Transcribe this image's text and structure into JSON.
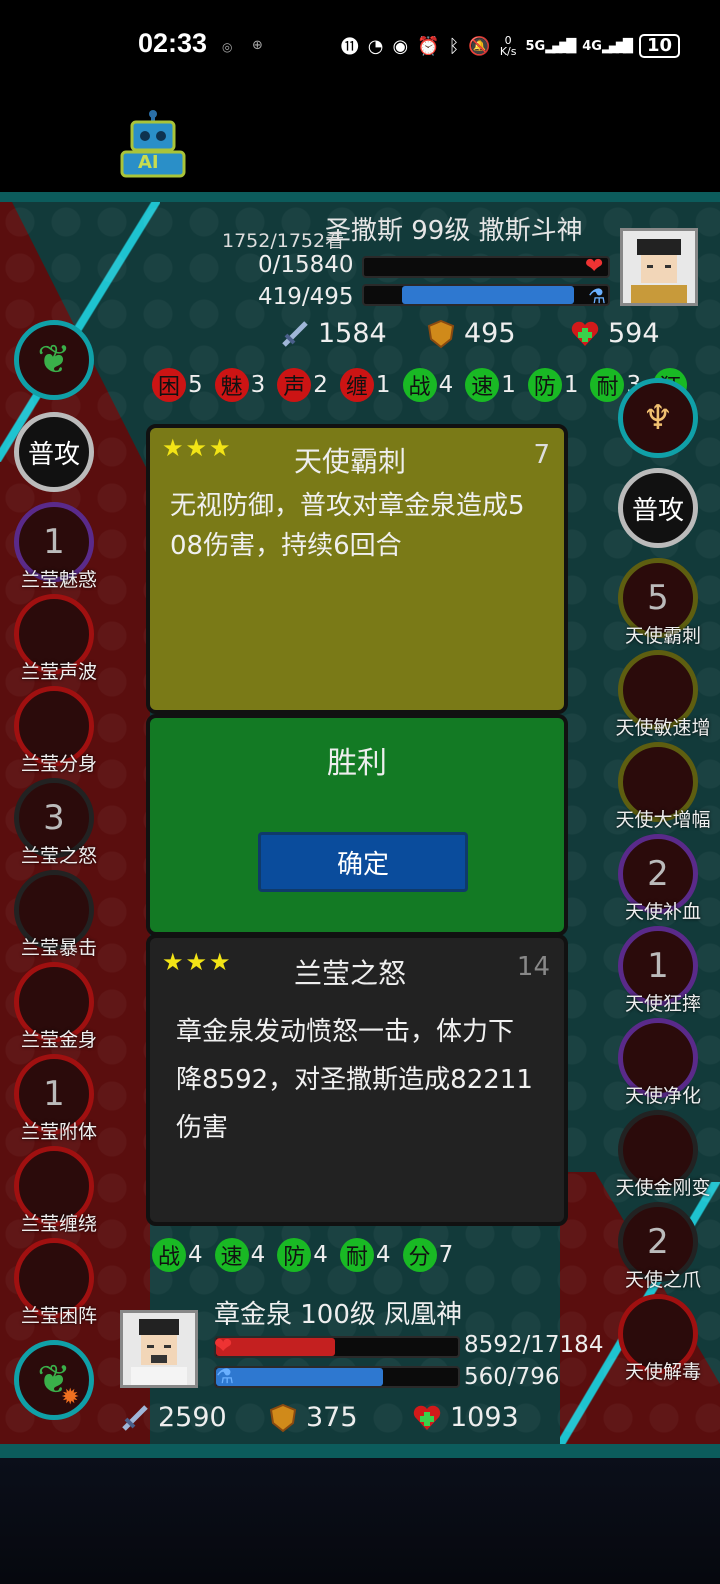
{
  "status_bar": {
    "time": "02:33",
    "net_speed": "0\nK/s",
    "net_5g": "5G",
    "net_4g": "4G",
    "battery": "10"
  },
  "ai_badge": "AI",
  "enemy": {
    "title": "圣撒斯 99级 撒斯斗神",
    "stamina": "1752/1752",
    "stamina_suffix": "看",
    "hp": "0/15840",
    "mp": "419/495",
    "hp_fraction": 0,
    "mp_fraction": 0.85,
    "attack": "1584",
    "defense": "495",
    "heal": "594"
  },
  "enemy_buffs": [
    {
      "label": "困",
      "count": "5",
      "color": "red"
    },
    {
      "label": "魅",
      "count": "3",
      "color": "red"
    },
    {
      "label": "声",
      "count": "2",
      "color": "red"
    },
    {
      "label": "缠",
      "count": "1",
      "color": "red"
    },
    {
      "label": "战",
      "count": "4",
      "color": "green"
    },
    {
      "label": "速",
      "count": "1",
      "color": "green"
    },
    {
      "label": "防",
      "count": "1",
      "color": "green"
    },
    {
      "label": "耐",
      "count": "3",
      "color": "green"
    },
    {
      "label": "狂",
      "count": "",
      "color": "green"
    }
  ],
  "left_skills": {
    "normal_attack": "普攻",
    "items": [
      {
        "label": "兰莹魅惑",
        "value": "1"
      },
      {
        "label": "兰莹声波",
        "value": ""
      },
      {
        "label": "兰莹分身",
        "value": ""
      },
      {
        "label": "兰莹之怒",
        "value": "3"
      },
      {
        "label": "兰莹暴击",
        "value": ""
      },
      {
        "label": "兰莹金身",
        "value": ""
      },
      {
        "label": "兰莹附体",
        "value": "1"
      },
      {
        "label": "兰莹缠绕",
        "value": ""
      },
      {
        "label": "兰莹困阵",
        "value": ""
      }
    ]
  },
  "right_skills": {
    "normal_attack": "普攻",
    "items": [
      {
        "label": "天使霸刺",
        "value": "5"
      },
      {
        "label": "天使敏速增",
        "value": ""
      },
      {
        "label": "天使大增幅",
        "value": ""
      },
      {
        "label": "天使补血",
        "value": "2"
      },
      {
        "label": "天使狂摔",
        "value": "1"
      },
      {
        "label": "天使净化",
        "value": ""
      },
      {
        "label": "天使金刚变",
        "value": ""
      },
      {
        "label": "天使之爪",
        "value": "2"
      },
      {
        "label": "天使解毒",
        "value": ""
      }
    ]
  },
  "card_top": {
    "title": "天使霸刺",
    "number": "7",
    "desc_line1": "无视防御，普攻对章金泉造成5",
    "desc_line2": "08伤害，持续6回合"
  },
  "dialog": {
    "title": "胜利",
    "confirm": "确定"
  },
  "card_bottom": {
    "title": "兰莹之怒",
    "number": "14",
    "desc_line1": "章金泉发动愤怒一击，体力下",
    "desc_line2": "降8592，对圣撒斯造成82211",
    "desc_line3": "伤害"
  },
  "player_buffs": [
    {
      "label": "战",
      "count": "4",
      "color": "green"
    },
    {
      "label": "速",
      "count": "4",
      "color": "green"
    },
    {
      "label": "防",
      "count": "4",
      "color": "green"
    },
    {
      "label": "耐",
      "count": "4",
      "color": "green"
    },
    {
      "label": "分",
      "count": "7",
      "color": "green"
    }
  ],
  "player": {
    "title": "章金泉 100级 凤凰神",
    "hp": "8592/17184",
    "mp": "560/796",
    "hp_fraction": 0.5,
    "mp_fraction": 0.7,
    "attack": "2590",
    "defense": "375",
    "heal": "1093"
  },
  "colors": {
    "board": "#123a3a",
    "red_zone": "#5a0e0e",
    "card_yellow": "#7a7a17",
    "card_green": "#137a24",
    "card_dark": "#222222",
    "button": "#0a4c9c"
  }
}
